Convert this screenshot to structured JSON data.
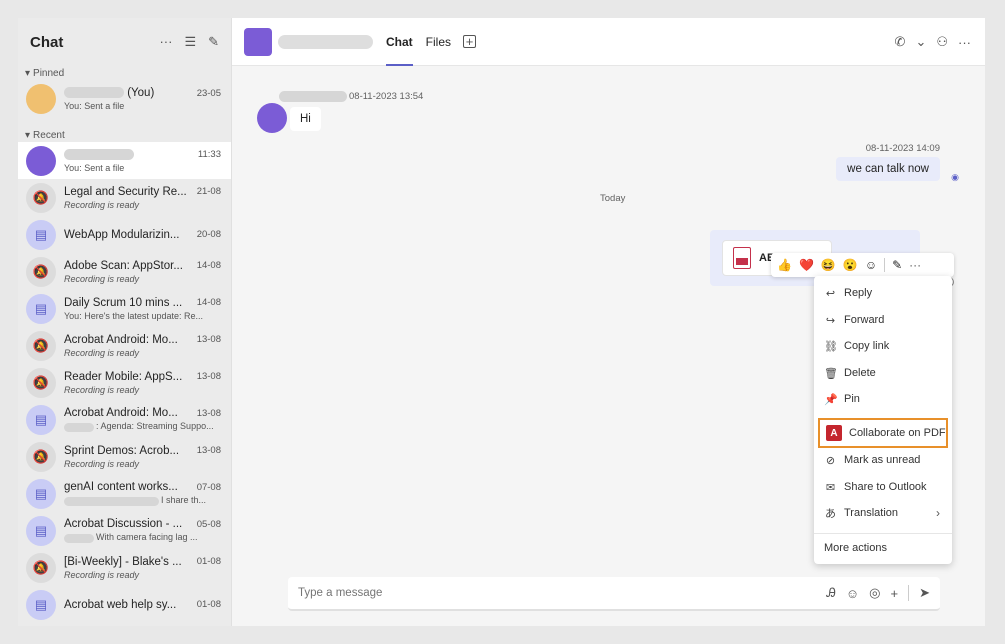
{
  "sidebar": {
    "title": "Chat",
    "pinned_label": "Pinned",
    "recent_label": "Recent",
    "pinned": [
      {
        "name_suffix": "(You)",
        "date": "23-05",
        "sub": "You: Sent a file"
      }
    ],
    "recent": [
      {
        "name": "",
        "date": "11:33",
        "sub": "You: Sent a file",
        "type": "user",
        "selected": true
      },
      {
        "name": "Legal and Security Re...",
        "date": "21-08",
        "sub": "Recording is ready",
        "type": "meet",
        "italic": true
      },
      {
        "name": "WebApp Modularizin...",
        "date": "20-08",
        "sub": "",
        "type": "cal"
      },
      {
        "name": "Adobe Scan: AppStor...",
        "date": "14-08",
        "sub": "Recording is ready",
        "type": "meet",
        "italic": true
      },
      {
        "name": "Daily Scrum 10 mins ...",
        "date": "14-08",
        "sub": "You: Here's the latest update: Re...",
        "type": "cal"
      },
      {
        "name": "Acrobat Android: Mo...",
        "date": "13-08",
        "sub": "Recording is ready",
        "type": "meet",
        "italic": true
      },
      {
        "name": "Reader Mobile: AppS...",
        "date": "13-08",
        "sub": "Recording is ready",
        "type": "meet",
        "italic": true
      },
      {
        "name": "Acrobat Android: Mo...",
        "date": "13-08",
        "sub": ": Agenda: Streaming Suppo...",
        "type": "cal",
        "blur_sub": true
      },
      {
        "name": "Sprint Demos: Acrob...",
        "date": "13-08",
        "sub": "Recording is ready",
        "type": "meet",
        "italic": true
      },
      {
        "name": "genAI content works...",
        "date": "07-08",
        "sub": "I share th...",
        "type": "cal",
        "blur_sub": true
      },
      {
        "name": "Acrobat Discussion - ...",
        "date": "05-08",
        "sub": "With camera facing lag ...",
        "type": "cal",
        "blur_sub": true
      },
      {
        "name": "[Bi-Weekly] - Blake's ...",
        "date": "01-08",
        "sub": "Recording is ready",
        "type": "meet",
        "italic": true
      },
      {
        "name": "Acrobat web help sy...",
        "date": "01-08",
        "sub": "",
        "type": "cal"
      }
    ]
  },
  "header": {
    "tabs": [
      "Chat",
      "Files"
    ],
    "active_tab": "Chat"
  },
  "messages": {
    "incoming_time": "08-11-2023 13:54",
    "incoming_text": "Hi",
    "outgoing_time": "08-11-2023 14:09",
    "outgoing_text": "we can talk now",
    "day_divider": "Today",
    "file_name": "ABC Ag"
  },
  "reactions": [
    "👍",
    "❤️",
    "😆",
    "😮",
    "☺"
  ],
  "context_menu": {
    "items": [
      "Reply",
      "Forward",
      "Copy link",
      "Delete",
      "Pin",
      "Collaborate on PDF",
      "Mark as unread",
      "Share to Outlook",
      "Translation",
      "More actions"
    ],
    "highlighted": "Collaborate on PDF"
  },
  "compose": {
    "placeholder": "Type a message"
  },
  "colors": {
    "accent": "#5b5fc7",
    "highlight_border": "#e8902a",
    "pdf_red": "#c4262e"
  }
}
